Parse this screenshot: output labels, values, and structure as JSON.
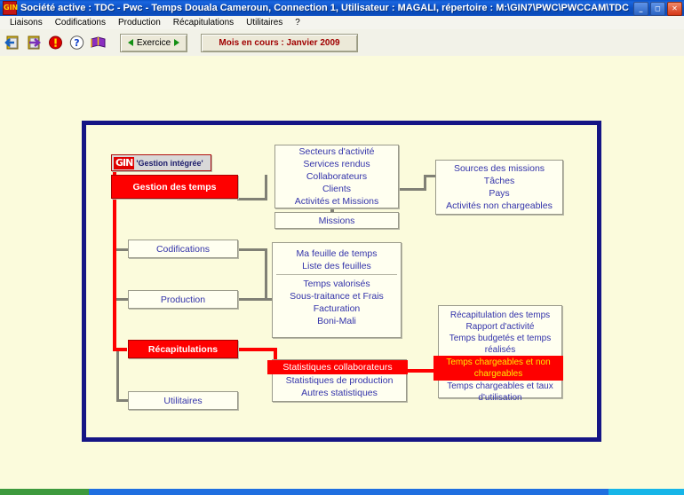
{
  "window": {
    "title": "Société active : TDC - Pwc - Temps Douala Cameroun, Connection 1, Utilisateur : MAGALI, répertoire : M:\\GIN7\\PWC\\PWCCAM\\TDC",
    "app_icon": "GIN",
    "buttons": {
      "minimize": "_",
      "maximize": "◻",
      "close": "✕"
    }
  },
  "menubar": {
    "items": [
      {
        "label": "Liaisons"
      },
      {
        "label": "Codifications"
      },
      {
        "label": "Production"
      },
      {
        "label": "Récapitulations"
      },
      {
        "label": "Utilitaires"
      },
      {
        "label": "?"
      }
    ]
  },
  "toolbar": {
    "icons": [
      {
        "name": "exit-door-icon"
      },
      {
        "name": "return-door-icon"
      },
      {
        "name": "alert-icon"
      },
      {
        "name": "help-icon"
      },
      {
        "name": "book-icon"
      }
    ],
    "exercise_label": "Exercice",
    "month_label": "Mois en cours : Janvier 2009"
  },
  "diagram": {
    "logo": {
      "mark": "GIN",
      "text": "'Gestion intégrée'"
    },
    "nodes": {
      "gestion_des_temps": "Gestion des temps",
      "codifications": "Codifications",
      "production": "Production",
      "recapitulations": "Récapitulations",
      "utilitaires": "Utilitaires",
      "missions": "Missions",
      "codifications_group": [
        "Secteurs d'activité",
        "Services rendus",
        "Collaborateurs",
        "Clients",
        "Activités et Missions"
      ],
      "sources_group": [
        "Sources des missions",
        "Tâches",
        "Pays",
        "Activités non chargeables"
      ],
      "production_group_top": [
        "Ma feuille de temps",
        "Liste des feuilles"
      ],
      "production_group_bottom": [
        "Temps valorisés",
        "Sous-traitance et Frais",
        "Facturation",
        "Boni-Mali"
      ],
      "statistiques_group": [
        "Statistiques collaborateurs",
        "Statistiques de production",
        "Autres statistiques"
      ],
      "recap_group": [
        "Récapitulation des temps",
        "Rapport d'activité",
        "Temps budgetés et temps réalisés",
        "Temps chargeables et non chargeables",
        "Temps chargeables et taux d'utilisation"
      ]
    },
    "colors": {
      "frame": "#151585",
      "highlight_bg": "#fe0000",
      "highlight_text": "#ffe800",
      "node_text": "#3333aa",
      "background": "#fbfbdc"
    }
  }
}
